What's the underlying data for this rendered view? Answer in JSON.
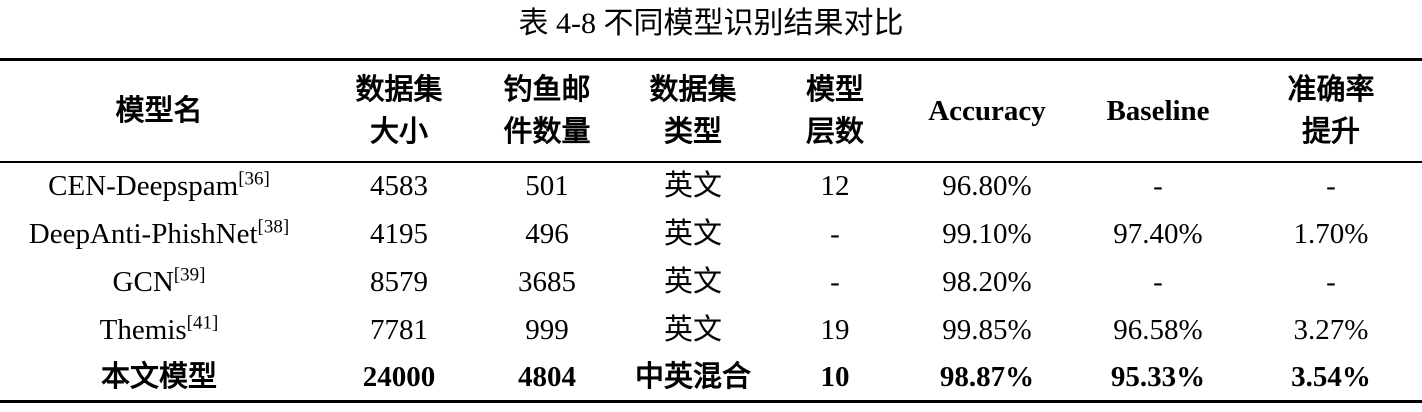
{
  "caption": "表 4-8  不同模型识别结果对比",
  "headers": {
    "model_name": "模型名",
    "dataset_size_1": "数据集",
    "dataset_size_2": "大小",
    "phishing_count_1": "钓鱼邮",
    "phishing_count_2": "件数量",
    "dataset_type_1": "数据集",
    "dataset_type_2": "类型",
    "layers_1": "模型",
    "layers_2": "层数",
    "accuracy": "Accuracy",
    "baseline": "Baseline",
    "improvement_1": "准确率",
    "improvement_2": "提升"
  },
  "rows": [
    {
      "model": "CEN-Deepspam",
      "ref": "[36]",
      "size": "4583",
      "phish": "501",
      "type": "英文",
      "layers": "12",
      "accuracy": "96.80%",
      "baseline": "-",
      "improvement": "-"
    },
    {
      "model": "DeepAnti-PhishNet",
      "ref": "[38]",
      "size": "4195",
      "phish": "496",
      "type": "英文",
      "layers": "-",
      "accuracy": "99.10%",
      "baseline": "97.40%",
      "improvement": "1.70%"
    },
    {
      "model": "GCN",
      "ref": "[39]",
      "size": "8579",
      "phish": "3685",
      "type": "英文",
      "layers": "-",
      "accuracy": "98.20%",
      "baseline": "-",
      "improvement": "-"
    },
    {
      "model": "Themis",
      "ref": "[41]",
      "size": "7781",
      "phish": "999",
      "type": "英文",
      "layers": "19",
      "accuracy": "99.85%",
      "baseline": "96.58%",
      "improvement": "3.27%"
    },
    {
      "model": "本文模型",
      "ref": "",
      "size": "24000",
      "phish": "4804",
      "type": "中英混合",
      "layers": "10",
      "accuracy": "98.87%",
      "baseline": "95.33%",
      "improvement": "3.54%"
    }
  ]
}
